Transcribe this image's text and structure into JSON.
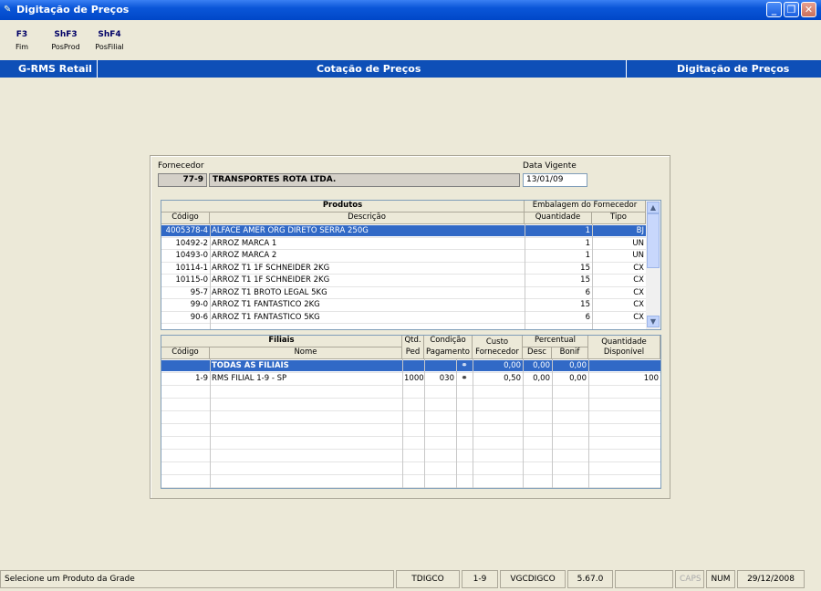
{
  "window": {
    "title": "Digitação de Preços",
    "min_icon": "minimize-icon",
    "restore_icon": "restore-icon",
    "close_icon": "close-icon"
  },
  "fkeys": [
    {
      "key": "F3",
      "label": "Fim"
    },
    {
      "key": "ShF3",
      "label": "PosProd"
    },
    {
      "key": "ShF4",
      "label": "PosFilial"
    }
  ],
  "header": {
    "left": "G-RMS Retail",
    "center": "Cotação de Preços",
    "right": "Digitação de Preços",
    "color": "#0e4fb7"
  },
  "form": {
    "fornecedor_label": "Fornecedor",
    "fornecedor_code": "77-9",
    "fornecedor_name": "TRANSPORTES ROTA LTDA.",
    "data_label": "Data Vigente",
    "data_value": "13/01/09"
  },
  "produtos": {
    "group": "Produtos",
    "embalagem": "Embalagem do Fornecedor",
    "col_codigo": "Código",
    "col_descricao": "Descrição",
    "col_quantidade": "Quantidade",
    "col_tipo": "Tipo",
    "rows": [
      {
        "codigo": "4005378-4",
        "descricao": "ALFACE AMER ORG DIRETO SERRA 250G",
        "quantidade": "1",
        "tipo": "BJ"
      },
      {
        "codigo": "10492-2",
        "descricao": "ARROZ MARCA 1",
        "quantidade": "1",
        "tipo": "UN"
      },
      {
        "codigo": "10493-0",
        "descricao": "ARROZ MARCA 2",
        "quantidade": "1",
        "tipo": "UN"
      },
      {
        "codigo": "10114-1",
        "descricao": "ARROZ T1 1F SCHNEIDER 2KG",
        "quantidade": "15",
        "tipo": "CX"
      },
      {
        "codigo": "10115-0",
        "descricao": "ARROZ T1 1F SCHNEIDER 2KG",
        "quantidade": "15",
        "tipo": "CX"
      },
      {
        "codigo": "95-7",
        "descricao": "ARROZ T1 BROTO LEGAL 5KG",
        "quantidade": "6",
        "tipo": "CX"
      },
      {
        "codigo": "99-0",
        "descricao": "ARROZ T1 FANTASTICO 2KG",
        "quantidade": "15",
        "tipo": "CX"
      },
      {
        "codigo": "90-6",
        "descricao": "ARROZ T1 FANTASTICO 5KG",
        "quantidade": "6",
        "tipo": "CX"
      }
    ]
  },
  "filiais": {
    "group": "Filiais",
    "col_codigo": "Código",
    "col_nome": "Nome",
    "qtd1": "Qtd.",
    "qtd2": "Ped",
    "cond1": "Condição",
    "cond2": "Pagamento",
    "custo1": "Custo",
    "custo2": "Fornecedor",
    "perc": "Percentual",
    "desc": "Desc",
    "bonif": "Bonif",
    "qd1": "Quantidade",
    "qd2": "Disponível",
    "rows": [
      {
        "codigo": "",
        "nome": "TODAS AS FILIAIS",
        "qtd": "",
        "cond": "",
        "custo": "0,00",
        "desc": "0,00",
        "bonif": "0,00",
        "disp": ""
      },
      {
        "codigo": "1-9",
        "nome": "RMS FILIAL 1-9 - SP",
        "qtd": "1000",
        "cond": "030",
        "custo": "0,50",
        "desc": "0,00",
        "bonif": "0,00",
        "disp": "100"
      }
    ]
  },
  "status": {
    "message": "Selecione um Produto da Grade",
    "f1": "TDIGCO",
    "f2": "1-9",
    "f3": "VGCDIGCO",
    "f4": "5.67.0",
    "f5": "",
    "caps": "CAPS",
    "num": "NUM",
    "date": "29/12/2008"
  }
}
